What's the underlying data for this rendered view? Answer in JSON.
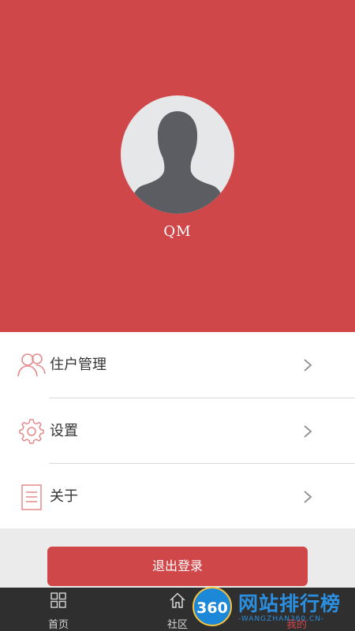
{
  "profile": {
    "username": "QM"
  },
  "menu": {
    "items": [
      {
        "label": "住户管理",
        "icon": "users-icon"
      },
      {
        "label": "设置",
        "icon": "gear-icon"
      },
      {
        "label": "关于",
        "icon": "document-icon"
      }
    ]
  },
  "actions": {
    "logout_label": "退出登录"
  },
  "tabbar": {
    "tabs": [
      {
        "label": "首页",
        "icon": "grid-icon"
      },
      {
        "label": "社区",
        "icon": "home-icon"
      },
      {
        "label": "我的",
        "icon": "person-icon",
        "active": true
      }
    ]
  },
  "watermark": {
    "badge": "360",
    "title": "网站排行榜",
    "subtitle": "-WANGZHAN360.CN-"
  },
  "colors": {
    "accent": "#d0474a",
    "tabbar": "#2f2f2f",
    "avatar_bg": "#e6e7e9",
    "avatar_silhouette": "#5c5d62"
  }
}
